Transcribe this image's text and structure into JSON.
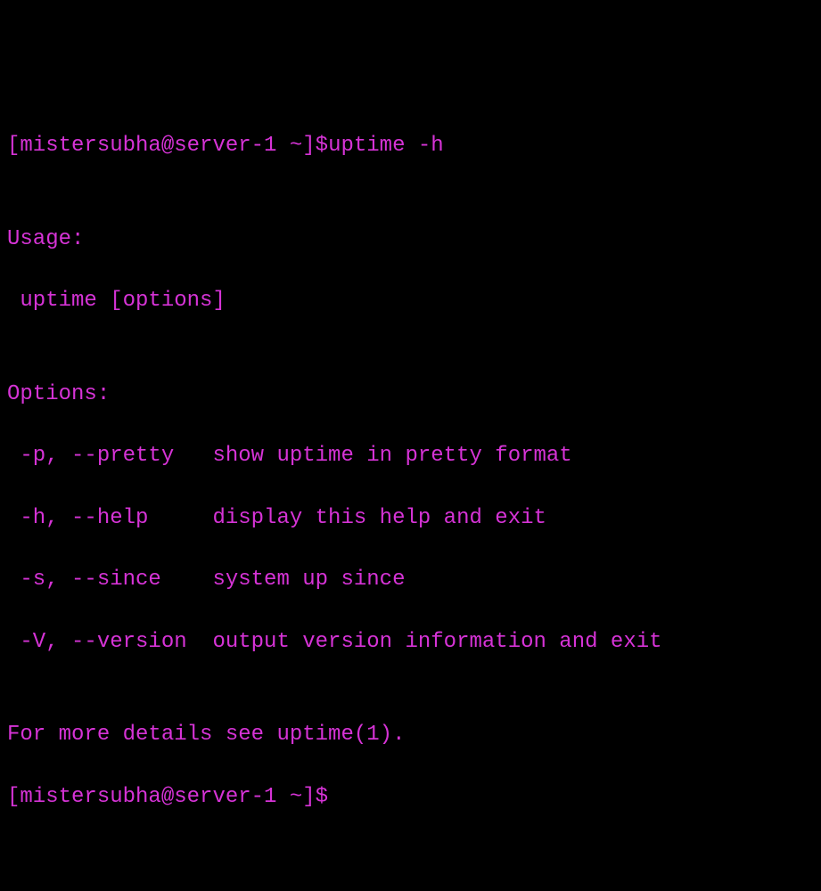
{
  "prompt1": {
    "user": "mistersubha",
    "host": "server-1",
    "path": "~",
    "full": "[mistersubha@server-1 ~]$",
    "command": "uptime -h"
  },
  "output": {
    "blank1": "",
    "usage_header": "Usage:",
    "usage_line": " uptime [options]",
    "blank2": "",
    "options_header": "Options:",
    "opt1": " -p, --pretty   show uptime in pretty format",
    "opt2": " -h, --help     display this help and exit",
    "opt3": " -s, --since    system up since",
    "opt4": " -V, --version  output version information and exit",
    "blank3": "",
    "footer": "For more details see uptime(1)."
  },
  "prompt2": {
    "full": "[mistersubha@server-1 ~]$"
  }
}
